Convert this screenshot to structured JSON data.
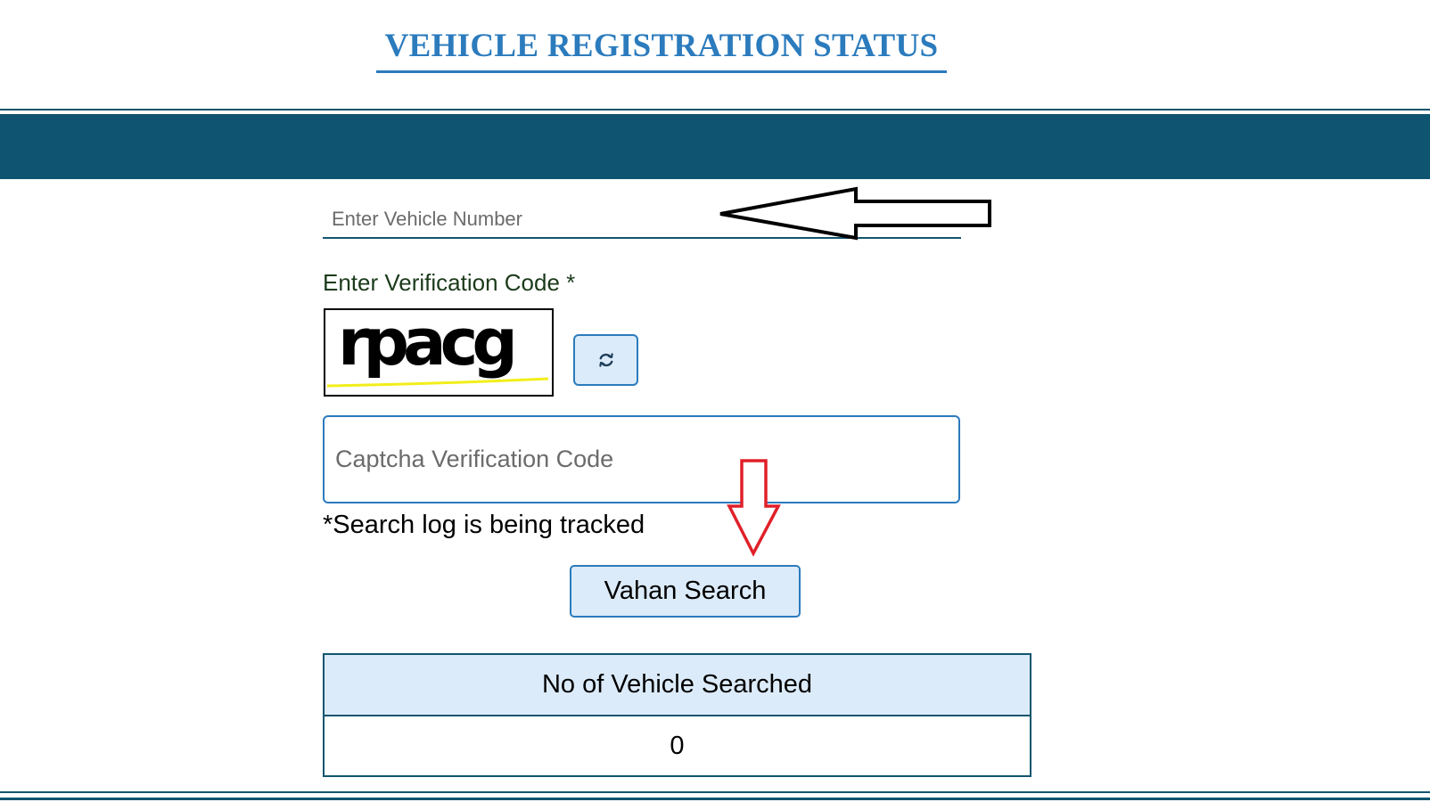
{
  "page": {
    "title": "VEHICLE REGISTRATION STATUS"
  },
  "form": {
    "vehicle_placeholder": "Enter Vehicle Number",
    "vehicle_value": "",
    "verification_label": "Enter Verification Code  *",
    "captcha_image_text": "rpacg",
    "refresh_icon": "refresh-icon",
    "captcha_placeholder": "Captcha Verification Code",
    "captcha_value": "",
    "tracking_note": "*Search log is being tracked",
    "search_button_label": "Vahan Search"
  },
  "stats": {
    "header": "No of Vehicle Searched",
    "value": "0"
  },
  "annotations": {
    "left_arrow_icon": "arrow-left-outline-icon",
    "down_arrow_icon": "arrow-down-outline-icon",
    "left_arrow_color": "#000000",
    "down_arrow_color": "#e0202a"
  },
  "colors": {
    "accent": "#2b7bbd",
    "header_band": "#0f5470",
    "button_bg": "#dcebf9"
  }
}
